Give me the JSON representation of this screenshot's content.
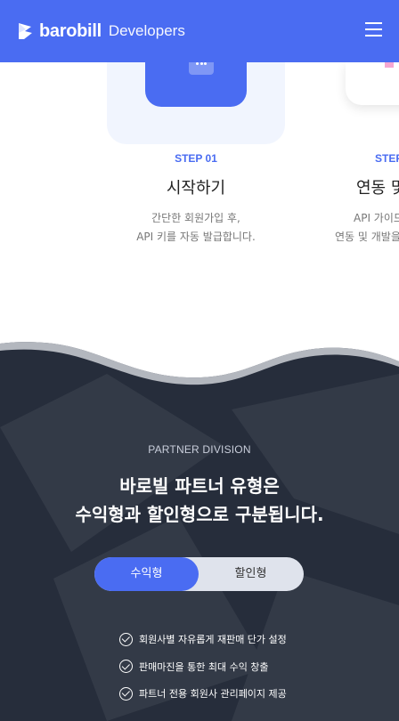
{
  "header": {
    "logo_text": "barobill",
    "logo_sub": "Developers",
    "menu_icon": "hamburger-menu-icon",
    "bg_color": "#4a6cf2"
  },
  "steps": [
    {
      "label": "STEP 01",
      "title": "시작하기",
      "desc_line1": "간단한 회원가입 후,",
      "desc_line2": "API 키를 자동 발급합니다.",
      "icon": "chat-bubble-icon"
    },
    {
      "label": "STEP",
      "title": "연동 및",
      "desc_line1": "API 가이드",
      "desc_line2": "연동 및 개발을"
    }
  ],
  "partner": {
    "eyebrow": "PARTNER DIVISION",
    "headline_line1": "바로빌 파트너 유형은",
    "headline_line2": "수익형과 할인형으로 구분됩니다.",
    "toggle": {
      "options": [
        "수익형",
        "할인형"
      ],
      "selected": "수익형"
    },
    "features": [
      "회원사별 자유롭게 재판매 단가 설정",
      "판매마진을 통한 최대 수익 창출",
      "파트너 전용 회원사 관리페이지 제공"
    ],
    "dark_bg_color": "#262d3b",
    "accent_color": "#4a6cf2"
  }
}
